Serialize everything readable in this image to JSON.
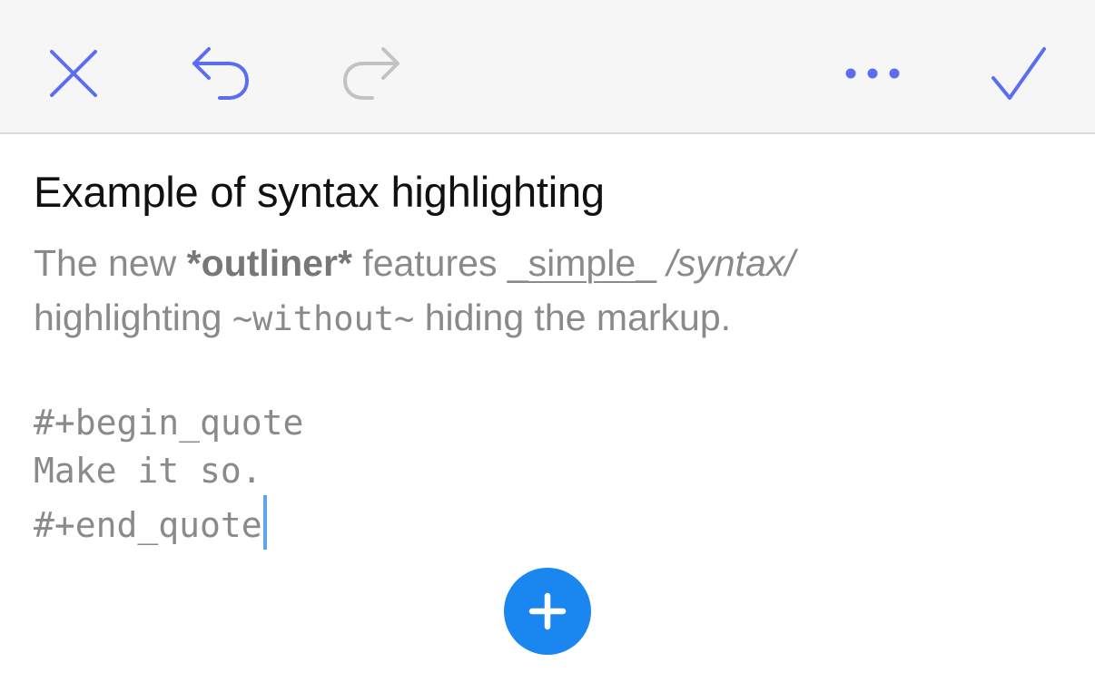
{
  "toolbar": {
    "close_icon": "close-icon",
    "undo_icon": "undo-icon",
    "redo_icon": "redo-icon",
    "more_icon": "more-horizontal-icon",
    "done_icon": "checkmark-icon"
  },
  "editor": {
    "title": "Example of syntax highlighting",
    "body": {
      "line1": {
        "t1": "The new ",
        "bold": "*outliner*",
        "t2": " features ",
        "u_pre": "_",
        "u_word": "simple",
        "u_post": "_",
        "t3": " ",
        "italic": "/syntax/"
      },
      "line2": {
        "t1": "highlighting ",
        "code": "~without~",
        "t2": " hiding the markup."
      }
    },
    "quote": {
      "begin": "#+begin_quote",
      "content": "Make it so.",
      "end": "#+end_quote"
    }
  },
  "fab": {
    "icon": "plus-icon"
  },
  "colors": {
    "accent": "#5b6ef0",
    "disabled": "#c2c2c2",
    "fab": "#1a86f0",
    "caret": "#5aa7f0",
    "markup_text": "#8a8a8a"
  }
}
